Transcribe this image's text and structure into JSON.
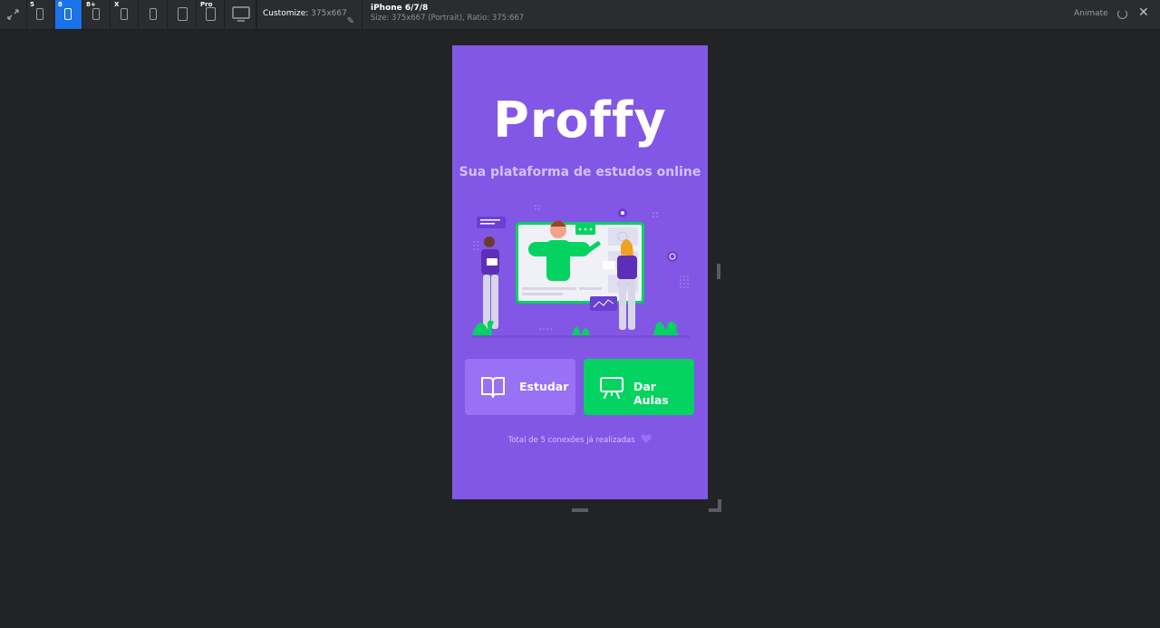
{
  "toolbar": {
    "devices": [
      {
        "sup": "5",
        "kind": "phone"
      },
      {
        "sup": "8",
        "kind": "phone",
        "active": true
      },
      {
        "sup": "8+",
        "kind": "phone"
      },
      {
        "sup": "X",
        "kind": "phone"
      },
      {
        "sup": "",
        "kind": "phone"
      },
      {
        "sup": "",
        "kind": "phone"
      },
      {
        "sup": "Pro",
        "kind": "tablet"
      },
      {
        "sup": "",
        "kind": "desktop"
      }
    ],
    "customize_label": "Customize:",
    "customize_value": "375x667",
    "device_title": "iPhone 6/7/8",
    "device_size": "Size: 375x667 (Portrait), Ratio: 375:667",
    "animate_label": "Animate"
  },
  "app": {
    "logo": "Proffy",
    "tagline": "Sua plataforma de estudos online",
    "study_button": "Estudar",
    "teach_button": "Dar Aulas",
    "connections_text": "Total de 5 conexões já realizadas",
    "colors": {
      "background": "#8257e6",
      "study_button": "#9871f5",
      "teach_button": "#04d361",
      "tagline": "#d4c2ff"
    }
  }
}
